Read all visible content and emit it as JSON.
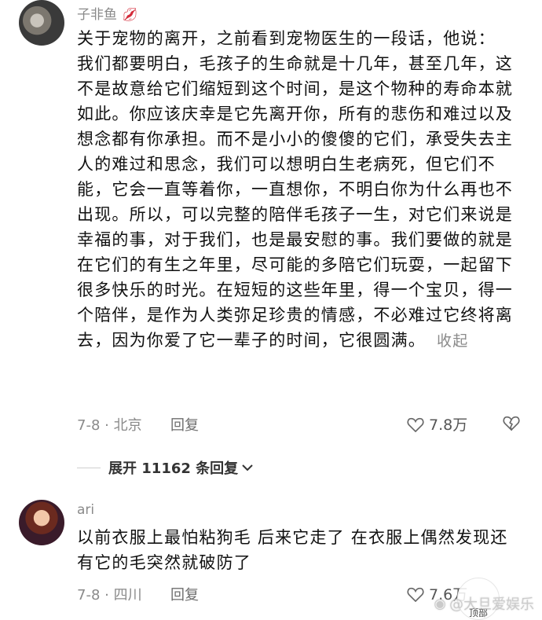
{
  "comments": [
    {
      "username": "子非鱼",
      "badge_icon": "lips-icon",
      "text_intro": "关于宠物的离开，之前看到宠物医生的一段话，他说：",
      "text_body": "我们都要明白，毛孩子的生命就是十几年，甚至几年，这不是故意给它们缩短到这个时间，是这个物种的寿命本就如此。你应该庆幸是它先离开你，所有的悲伤和难过以及想念都有你承担。而不是小小的傻傻的它们，承受失去主人的难过和思念，我们可以想明白生老病死，但它们不能，它会一直等着你，一直想你，不明白你为什么再也不出现。所以，可以完整的陪伴毛孩子一生，对它们来说是幸福的事，对于我们，也是最安慰的事。我们要做的就是在它们的有生之年里，尽可能的多陪它们玩耍，一起留下很多快乐的时光。在短短的这些年里，得一个宝贝，得一个陪伴，是作为人类弥足珍贵的情感，不必难过它终将离去，因为你爱了它一辈子的时间，它很圆满。",
      "collapse_label": "收起",
      "date_location": "7-8 · 北京",
      "reply_label": "回复",
      "likes": "7.8万"
    },
    {
      "username": "ari",
      "text_body": "以前衣服上最怕粘狗毛 后来它走了 在衣服上偶然发现还有它的毛突然就破防了",
      "date_location": "7-8 · 四川",
      "reply_label": "回复",
      "likes": "7.6万"
    }
  ],
  "expand_replies": "展开 11162 条回复",
  "watermark": "@大旦爱娱乐",
  "top_button": "顶部"
}
